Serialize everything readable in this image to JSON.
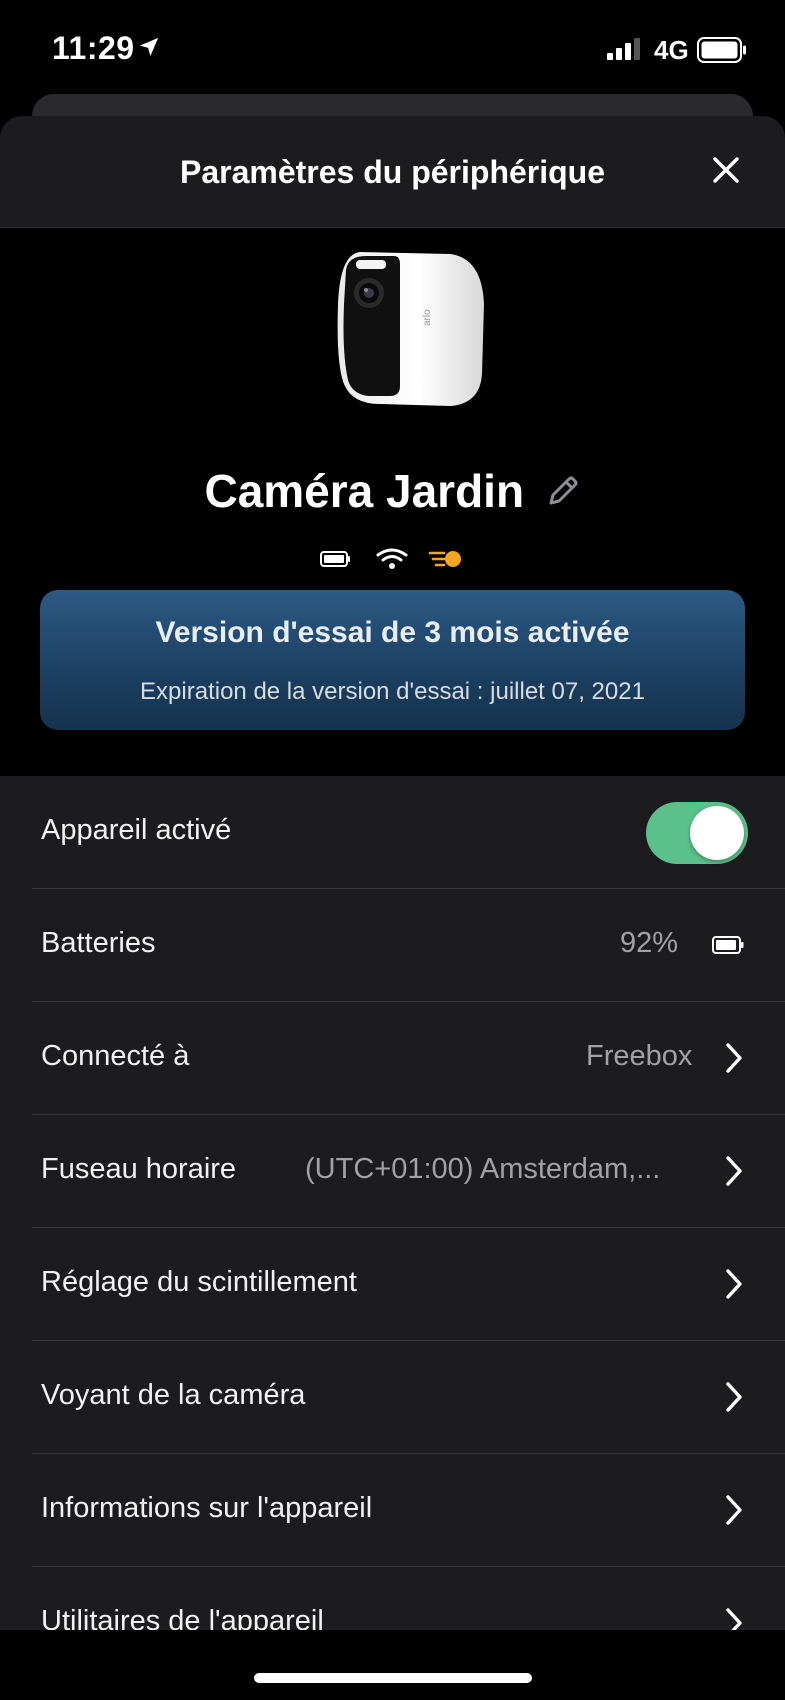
{
  "status_bar": {
    "time": "11:29",
    "network": "4G"
  },
  "header": {
    "title": "Paramètres du périphérique"
  },
  "device": {
    "name": "Caméra Jardin"
  },
  "trial": {
    "title": "Version d'essai de 3 mois activée",
    "subtitle": "Expiration de la version d'essai : juillet 07, 2021"
  },
  "settings": [
    {
      "label": "Appareil activé",
      "type": "toggle",
      "enabled": true
    },
    {
      "label": "Batteries",
      "value": "92%",
      "type": "battery"
    },
    {
      "label": "Connecté à",
      "value": "Freebox",
      "type": "link"
    },
    {
      "label": "Fuseau horaire",
      "value": "(UTC+01:00) Amsterdam,...",
      "type": "link"
    },
    {
      "label": "Réglage du scintillement",
      "type": "link"
    },
    {
      "label": "Voyant de la caméra",
      "type": "link"
    },
    {
      "label": "Informations sur l'appareil",
      "type": "link"
    },
    {
      "label": "Utilitaires de l'appareil",
      "type": "link"
    }
  ],
  "colors": {
    "toggle_on": "#5bc08a",
    "trial_banner": "#1f4566",
    "list_background": "#1c1c1e",
    "light_indicator": "#f5a623"
  },
  "icons": {
    "status_bar": [
      "location-arrow-icon",
      "signal-icon",
      "battery-icon"
    ],
    "header": [
      "close-icon"
    ],
    "device": [
      "camera-image",
      "edit-pencil-icon",
      "battery-status-icon",
      "wifi-icon",
      "light-status-icon"
    ],
    "rows": [
      "small-battery-icon",
      "chevron-right-icon"
    ]
  }
}
